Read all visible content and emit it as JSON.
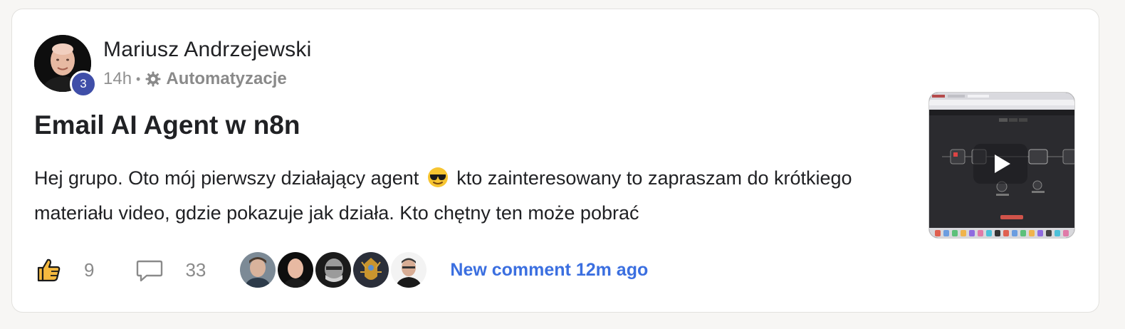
{
  "post": {
    "author": {
      "name": "Mariusz Andrzejewski",
      "level": "3"
    },
    "time": "14h",
    "separator": "•",
    "category": {
      "icon": "gear-icon",
      "label": "Automatyzacje"
    },
    "title": "Email AI Agent w n8n",
    "body": {
      "before_emoji": "Hej grupo. Oto mój pierwszy działający agent",
      "emoji": "smiling-face-with-sunglasses",
      "after_emoji": "kto zainteresowany to zapraszam do krótkiego materiału video, gdzie pokazuje jak działa. Kto chętny ten może pobrać"
    },
    "media": {
      "type": "video",
      "icon": "play-icon"
    },
    "likes": "9",
    "comments": "33",
    "commenters": [
      "avatar-1",
      "avatar-2",
      "avatar-3",
      "avatar-4",
      "avatar-5"
    ],
    "new_comment": "New comment 12m ago"
  },
  "colors": {
    "accent_link": "#3b6fe0",
    "level_badge": "#3f4ea8",
    "muted_text": "#909090",
    "like_icon": "#f5b93f"
  }
}
